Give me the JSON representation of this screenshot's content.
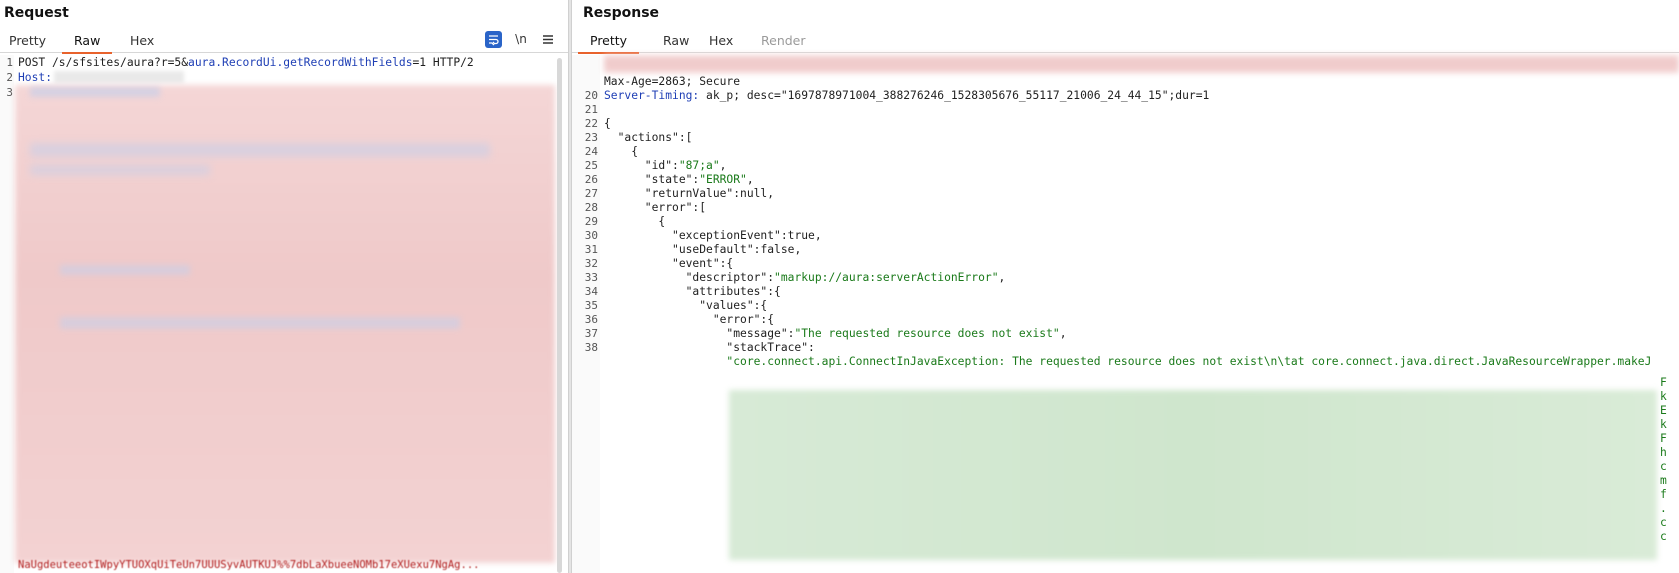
{
  "request": {
    "title": "Request",
    "tabs": [
      "Pretty",
      "Raw",
      "Hex"
    ],
    "active_tab": "Raw",
    "toolbar": {
      "newline_label": "\\n"
    },
    "lines": {
      "n1": "1",
      "n2": "2",
      "n3": "3",
      "l1_a": "POST /s/sfsites/aura?r=5&",
      "l1_b": "aura.RecordUi.getRecordWithFields",
      "l1_c": "=1",
      "l1_d": " HTTP/2",
      "l2": "Host:",
      "bottom": "NaUgdeuteeotIWpyYTUOXqUiTeUn7UUUSyvAUTKUJ%%7dbLaXbueeNOMb17eXUexu7NgAg..."
    }
  },
  "response": {
    "title": "Response",
    "tabs": [
      "Pretty",
      "Raw",
      "Hex",
      "Render"
    ],
    "active_tab": "Pretty",
    "lines": [
      {
        "n": "",
        "t": "Max-Age=2863; Secure"
      },
      {
        "n": "20",
        "k": "Server-Timing:",
        "t": " ak_p; desc=\"1697878971004_388276246_1528305676_55117_21006_24_44_15\";dur=1"
      },
      {
        "n": "21",
        "t": ""
      },
      {
        "n": "22",
        "t": "{"
      },
      {
        "n": "23",
        "t": "  \"actions\":["
      },
      {
        "n": "24",
        "t": "    {"
      },
      {
        "n": "25",
        "k": "      \"id\":",
        "v": "\"87;a\"",
        "e": ","
      },
      {
        "n": "26",
        "k": "      \"state\":",
        "v": "\"ERROR\"",
        "e": ","
      },
      {
        "n": "27",
        "k": "      \"returnValue\":",
        "b": "null",
        "e": ","
      },
      {
        "n": "28",
        "t": "      \"error\":["
      },
      {
        "n": "29",
        "t": "        {"
      },
      {
        "n": "30",
        "k": "          \"exceptionEvent\":",
        "b": "true",
        "e": ","
      },
      {
        "n": "31",
        "k": "          \"useDefault\":",
        "b": "false",
        "e": ","
      },
      {
        "n": "32",
        "t": "          \"event\":{"
      },
      {
        "n": "33",
        "k": "            \"descriptor\":",
        "v": "\"markup://aura:serverActionError\"",
        "e": ","
      },
      {
        "n": "34",
        "t": "            \"attributes\":{"
      },
      {
        "n": "35",
        "t": "              \"values\":{"
      },
      {
        "n": "36",
        "t": "                \"error\":{"
      },
      {
        "n": "37",
        "k": "                  \"message\":",
        "v": "\"The requested resource does not exist\"",
        "e": ","
      },
      {
        "n": "38",
        "t": "                  \"stackTrace\":"
      },
      {
        "n": "",
        "v": "                  \"core.connect.api.ConnectInJavaException: The requested resource does not exist\\n\\tat core.connect.java.direct.JavaResourceWrapper.makeJ"
      }
    ],
    "side_chars": [
      "F",
      "k",
      "E",
      "k",
      "F",
      "h",
      "c",
      "m",
      "f",
      ".",
      "c",
      "c"
    ]
  },
  "colors": {
    "accent": "#e8622c",
    "string": "#1a7a1a",
    "keyword": "#1f3fb5",
    "header_name": "#1f3fb5",
    "redacted_red": "#f0cccc",
    "redacted_green": "#d3e8d1"
  }
}
